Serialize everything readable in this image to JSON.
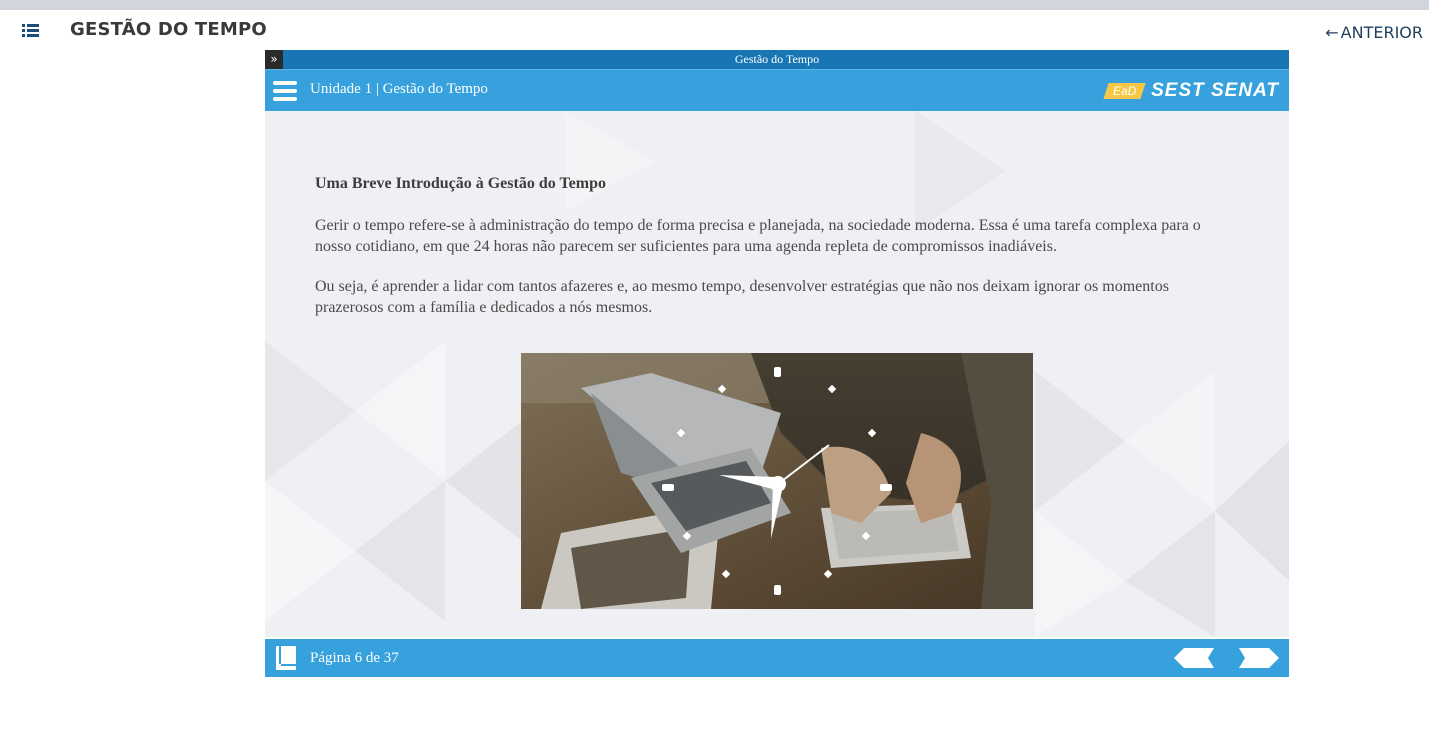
{
  "app": {
    "title": "GESTÃO DO TEMPO",
    "prev_link": "ANTERIOR",
    "prev_arrow": "←"
  },
  "player": {
    "window_title": "Gestão do Tempo",
    "expand_glyph": "»",
    "unit_title": "Unidade 1 | Gestão do Tempo",
    "brand": {
      "ead": "EaD",
      "name": "SEST SENAT"
    }
  },
  "content": {
    "heading": "Uma Breve Introdução à Gestão do Tempo",
    "paragraphs": [
      "Gerir o tempo refere-se à administração do tempo de forma precisa e planejada, na sociedade moderna. Essa é uma tarefa complexa para o nosso cotidiano, em que 24 horas não parecem ser suficientes para uma agenda repleta de compromissos inadiáveis.",
      "Ou seja, é aprender a lidar com tantos afazeres e, ao mesmo tempo, desenvolver estratégias que não nos deixam ignorar os momentos prazerosos com a família e dedicados a nós mesmos."
    ]
  },
  "footer": {
    "page_counter": "Página 6 de 37"
  },
  "colors": {
    "accent_blue": "#36a1dc",
    "title_bar_blue": "#1976b5",
    "brand_yellow": "#f6c646",
    "title_text": "#3a3a3a",
    "link_text": "#1d3f5e"
  },
  "icons": {
    "menu": "list-icon",
    "hamburger": "hamburger-icon",
    "book": "book-icon",
    "prev": "arrow-left-icon",
    "next": "arrow-right-icon"
  }
}
